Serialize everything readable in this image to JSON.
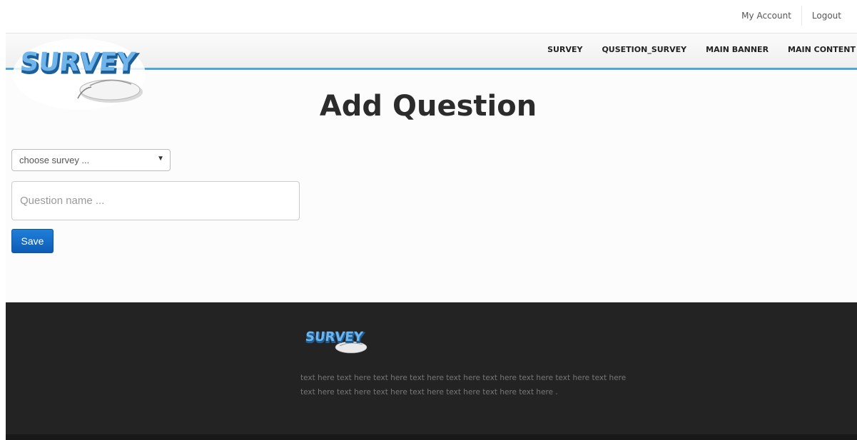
{
  "header": {
    "account_label": "My Account",
    "logout_label": "Logout",
    "logo_text": "SURVEY"
  },
  "nav": {
    "items": [
      {
        "label": "SURVEY"
      },
      {
        "label": "QUSETION_SURVEY"
      },
      {
        "label": "MAIN BANNER"
      },
      {
        "label": "MAIN CONTENT"
      }
    ]
  },
  "main": {
    "title": "Add Question",
    "survey_select": {
      "selected": "choose survey ..."
    },
    "question_input": {
      "placeholder": "Question name ...",
      "value": ""
    },
    "save_label": "Save"
  },
  "footer": {
    "logo_text": "SURVEY",
    "text": "text here text here text here text here text here text here text here text here text here text here text here text here text here text here text here text here ."
  },
  "colors": {
    "accent": "#4aa7d6",
    "button": "#1f7fd9",
    "footer_bg": "#232323",
    "logo_blue": "#5aa9e6"
  }
}
